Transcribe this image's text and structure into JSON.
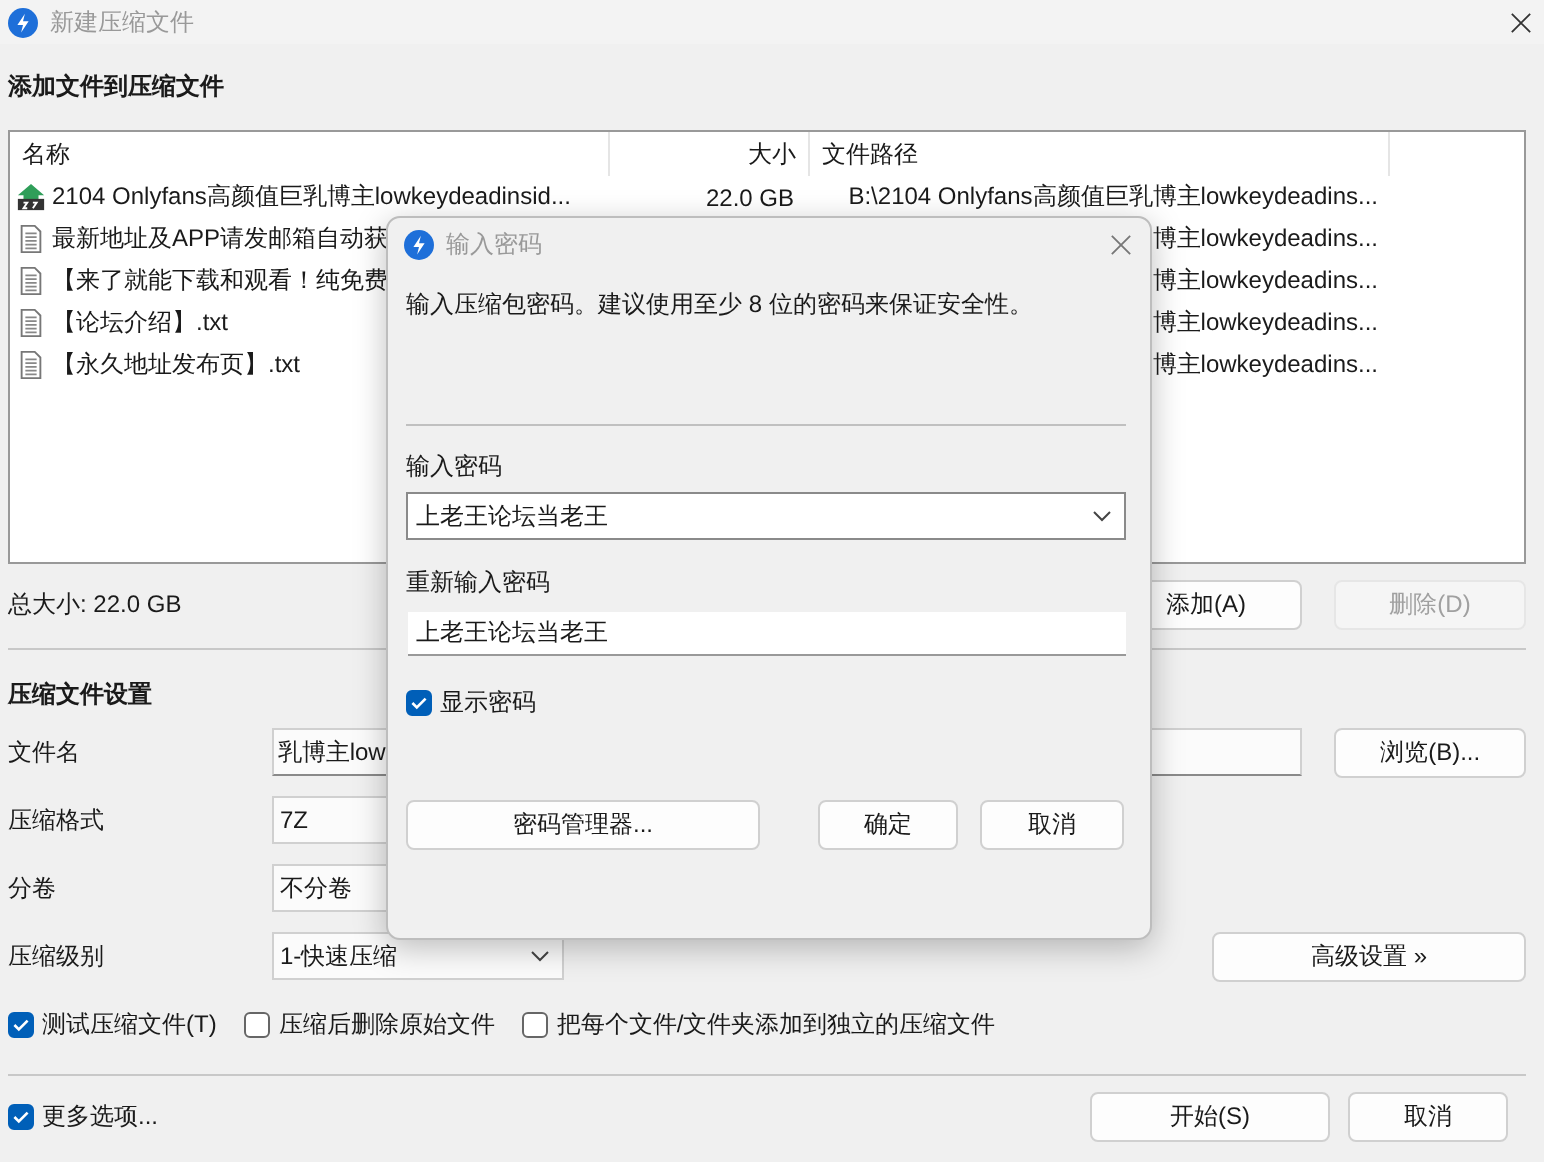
{
  "window": {
    "title": "新建压缩文件"
  },
  "files": {
    "heading": "添加文件到压缩文件",
    "columns": [
      "名称",
      "大小",
      "文件路径"
    ],
    "rows": [
      {
        "kind": "archive",
        "name": "2104 Onlyfans高颜值巨乳博主lowkeydeadinsid...",
        "size": "22.0 GB",
        "path": "B:\\2104 Onlyfans高颜值巨乳博主lowkeydeadins..."
      },
      {
        "kind": "text",
        "name": "最新地址及APP请发邮箱自动获",
        "path": "博主lowkeydeadins..."
      },
      {
        "kind": "text",
        "name": "【来了就能下载和观看！纯免费",
        "path": "博主lowkeydeadins..."
      },
      {
        "kind": "text",
        "name": "【论坛介绍】.txt",
        "path": "博主lowkeydeadins..."
      },
      {
        "kind": "text",
        "name": "【永久地址发布页】.txt",
        "path": "博主lowkeydeadins..."
      }
    ],
    "total_size": "总大小: 22.0 GB",
    "buttons": [
      {
        "label": "添加(A)",
        "disabled": false
      },
      {
        "label": "删除(D)",
        "disabled": true
      }
    ]
  },
  "settings": {
    "heading": "压缩文件设置",
    "fields": [
      {
        "kind": "input",
        "label": "文件名",
        "value": "乳博主low"
      },
      {
        "kind": "select",
        "label": "压缩格式",
        "value": "7Z"
      },
      {
        "kind": "select",
        "label": "分卷",
        "value": "不分卷"
      },
      {
        "kind": "dropdown",
        "label": "压缩级别",
        "value": "1-快速压缩"
      }
    ],
    "browse_button": "浏览(B)...",
    "advanced_button": "高级设置 »",
    "options": [
      {
        "label": "测试压缩文件(T)",
        "checked": true
      },
      {
        "label": "压缩后删除原始文件",
        "checked": false
      },
      {
        "label": "把每个文件/文件夹添加到独立的压缩文件",
        "checked": false
      }
    ]
  },
  "footer": {
    "more_options": {
      "label": "更多选项...",
      "checked": true
    },
    "buttons": [
      "开始(S)",
      "取消"
    ]
  },
  "dialog": {
    "title": "输入密码",
    "description": "输入压缩包密码。建议使用至少 8 位的密码来保证安全性。",
    "password_label": "输入密码",
    "password": "上老王论坛当老王",
    "confirm_label": "重新输入密码",
    "confirm": "上老王论坛当老王",
    "show_password": {
      "label": "显示密码",
      "checked": true
    },
    "buttons": [
      "密码管理器...",
      "确定",
      "取消"
    ]
  }
}
